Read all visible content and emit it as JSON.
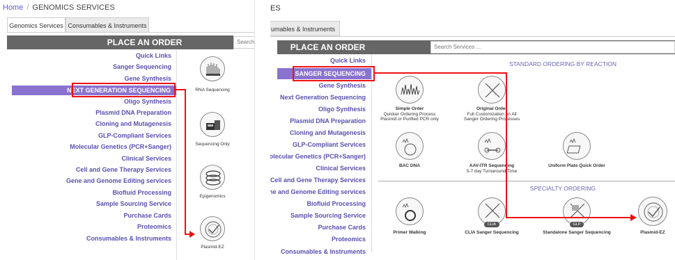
{
  "left": {
    "breadcrumb": {
      "home": "Home",
      "current": "GENOMICS SERVICES"
    },
    "tabs": [
      {
        "label": "Genomics Services"
      },
      {
        "label": "Consumables & Instruments"
      }
    ],
    "order_title": "PLACE AN ORDER",
    "search_placeholder": "Search",
    "menu": [
      "Quick Links",
      "Sanger Sequencing",
      "Gene Synthesis",
      "NEXT GENERATION SEQUENCING",
      "Oligo Synthesis",
      "Plasmid DNA Preparation",
      "Cloning and Mutagenesis",
      "GLP-Compliant Services",
      "Molecular Genetics (PCR+Sanger)",
      "Clinical Services",
      "Cell and Gene Therapy Services",
      "Gene and Genome Editing services",
      "Biofluid Processing",
      "Sample Sourcing Service",
      "Purchase Cards",
      "Proteomics",
      "Consumables & Instruments"
    ],
    "icons": [
      {
        "label": "RNA Sequencing",
        "icon": "rna-seq-icon"
      },
      {
        "label": "Sequencing Only",
        "icon": "sequencer-icon"
      },
      {
        "label": "Epigenomics",
        "icon": "epigenomics-icon"
      },
      {
        "label": "Plasmid-EZ",
        "icon": "plasmid-check-icon"
      }
    ]
  },
  "right": {
    "breadcrumb_fragment": "ES",
    "tab_fragment": "umables & Instruments",
    "order_title": "PLACE AN ORDER",
    "search_placeholder": "Search Services ...",
    "menu": [
      "Quick Links",
      "SANGER SEQUENCING",
      "Gene Synthesis",
      "Next Generation Sequencing",
      "Oligo Synthesis",
      "Plasmid DNA Preparation",
      "Cloning and Mutagenesis",
      "GLP-Compliant Services",
      "Molecular Genetics (PCR+Sanger)",
      "Clinical Services",
      "Cell and Gene Therapy Services",
      "Gene and Genome Editing services",
      "Biofluid Processing",
      "Sample Sourcing Service",
      "Purchase Cards",
      "Proteomics",
      "Consumables & Instruments"
    ],
    "standard_title": "STANDARD ORDERING BY REACTION",
    "specialty_title": "SPECIALTY ORDERING",
    "standard_items": [
      {
        "title": "Simple Order",
        "sub1": "Quicker Ordering Process",
        "sub2": "Plasmid or Purified PCR only",
        "icon": "chromatogram-icon"
      },
      {
        "title": "Original Order",
        "sub1": "Full Customization on All",
        "sub2": "Sanger Ordering Processes",
        "icon": "dna-helix-icon"
      },
      {
        "title": "BAC DNA",
        "sub1": "",
        "sub2": "",
        "icon": "bac-dna-icon"
      },
      {
        "title": "AAV-ITR Sequencing",
        "sub1": "5-7 day Turnaround Time",
        "sub2": "",
        "icon": "aav-itr-icon"
      },
      {
        "title": "Uniform Plate Quick Order",
        "sub1": "",
        "sub2": "",
        "icon": "plate-icon"
      }
    ],
    "specialty_items": [
      {
        "title": "Primer Walking",
        "icon": "primer-walking-icon"
      },
      {
        "title": "CLIA Sanger Sequencing",
        "icon": "clia-icon",
        "badge": "CLIA"
      },
      {
        "title": "Standalone Sanger Sequencing",
        "icon": "glp-icon",
        "badge": "GLP"
      },
      {
        "title": "Plasmid-EZ",
        "icon": "plasmid-check-icon"
      }
    ]
  },
  "colors": {
    "accent": "#8a72cf",
    "menu_text": "#5a4fb0",
    "highlight_red": "#e11111",
    "bar": "#666666"
  }
}
